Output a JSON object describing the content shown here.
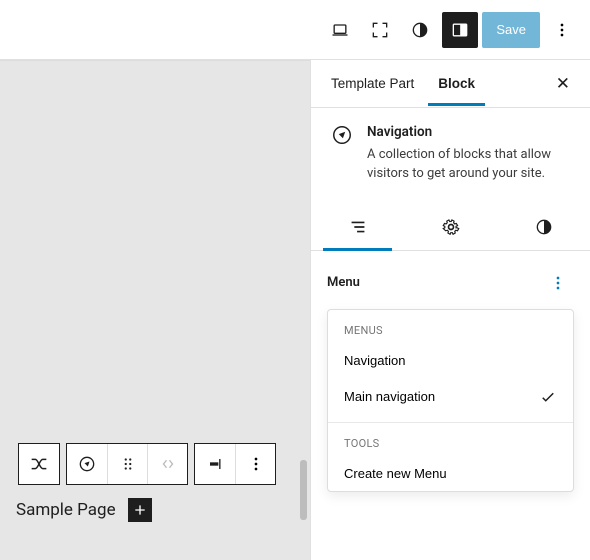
{
  "topbar": {
    "save_label": "Save"
  },
  "sidebar": {
    "tabs": {
      "template_part": "Template Part",
      "block": "Block"
    },
    "block": {
      "title": "Navigation",
      "description": "A collection of blocks that allow visitors to get around your site."
    },
    "menu": {
      "label": "Menu",
      "dropdown": {
        "menus_heading": "Menus",
        "items": [
          {
            "label": "Navigation",
            "selected": false
          },
          {
            "label": "Main navigation",
            "selected": true
          }
        ],
        "tools_heading": "Tools",
        "create_label": "Create new Menu"
      }
    }
  },
  "canvas": {
    "sample_label": "Sample Page"
  }
}
